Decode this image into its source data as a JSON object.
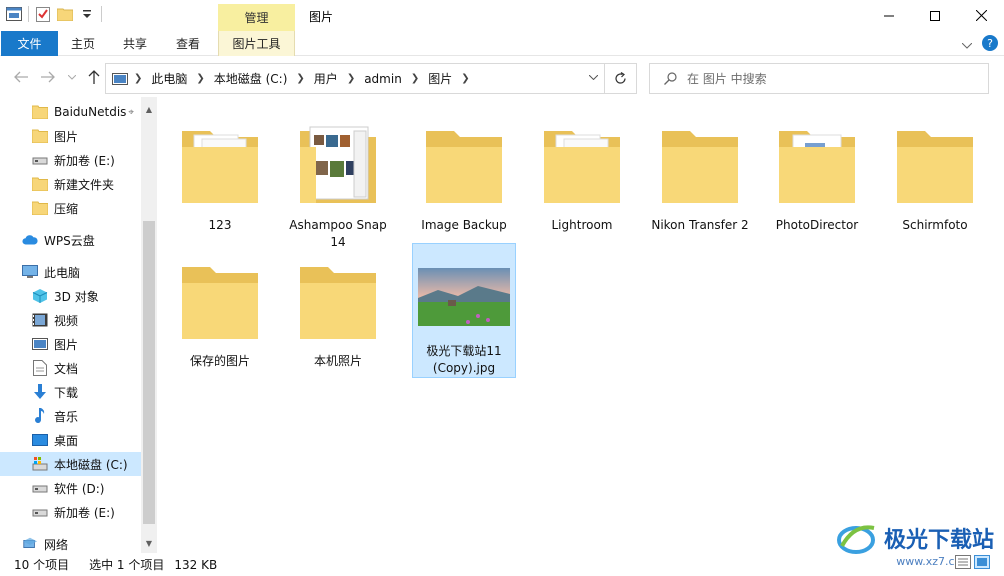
{
  "window": {
    "title": "图片",
    "context_tab_group": "管理"
  },
  "ribbon": {
    "tabs": [
      "文件",
      "主页",
      "共享",
      "查看",
      "图片工具"
    ]
  },
  "address": {
    "crumbs": [
      "此电脑",
      "本地磁盘 (C:)",
      "用户",
      "admin",
      "图片"
    ]
  },
  "search": {
    "placeholder": "在 图片 中搜索"
  },
  "nav": {
    "items": [
      {
        "label": "BaiduNetdis",
        "icon": "folder-icon"
      },
      {
        "label": "图片",
        "icon": "folder-icon"
      },
      {
        "label": "新加卷 (E:)",
        "icon": "drive-icon"
      },
      {
        "label": "新建文件夹",
        "icon": "folder-icon"
      },
      {
        "label": "压缩",
        "icon": "folder-icon"
      },
      {
        "label": "WPS云盘",
        "icon": "cloud-icon"
      },
      {
        "label": "此电脑",
        "icon": "computer-icon"
      },
      {
        "label": "3D 对象",
        "icon": "cube-icon"
      },
      {
        "label": "视频",
        "icon": "video-icon"
      },
      {
        "label": "图片",
        "icon": "pictures-icon"
      },
      {
        "label": "文档",
        "icon": "document-icon"
      },
      {
        "label": "下载",
        "icon": "download-icon"
      },
      {
        "label": "音乐",
        "icon": "music-icon"
      },
      {
        "label": "桌面",
        "icon": "desktop-icon"
      },
      {
        "label": "本地磁盘 (C:)",
        "icon": "system-drive-icon"
      },
      {
        "label": "软件 (D:)",
        "icon": "drive-icon"
      },
      {
        "label": "新加卷 (E:)",
        "icon": "drive-icon"
      },
      {
        "label": "网络",
        "icon": "network-icon"
      }
    ]
  },
  "files": [
    {
      "name": "123",
      "kind": "folder-docs"
    },
    {
      "name": "Ashampoo Snap 14",
      "kind": "folder-photos"
    },
    {
      "name": "Image Backup",
      "kind": "folder"
    },
    {
      "name": "Lightroom",
      "kind": "folder-docs"
    },
    {
      "name": "Nikon Transfer 2",
      "kind": "folder"
    },
    {
      "name": "PhotoDirector",
      "kind": "folder-blue"
    },
    {
      "name": "Schirmfoto",
      "kind": "folder"
    },
    {
      "name": "保存的图片",
      "kind": "folder"
    },
    {
      "name": "本机照片",
      "kind": "folder"
    },
    {
      "name": "极光下载站11 (Copy).jpg",
      "kind": "image"
    }
  ],
  "status": {
    "count": "10 个项目",
    "selected": "选中 1 个项目",
    "size": "132 KB"
  },
  "watermark": {
    "text": "极光下载站",
    "url": "www.xz7.com"
  },
  "colors": {
    "accent": "#1979ca",
    "selection": "#cce8ff",
    "folder": "#f7d679",
    "context_tab": "#f8efa0"
  }
}
